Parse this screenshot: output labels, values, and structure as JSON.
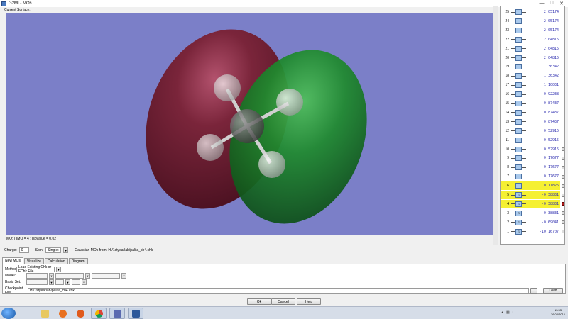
{
  "window": {
    "title": "G2MI - MOs",
    "controls": [
      "minimize",
      "maximize",
      "close"
    ]
  },
  "surface_label": "Current Surface:",
  "status_line": "MO: ( IMO = 4 ; Isovalue = 0.02 )",
  "mo_list": [
    {
      "num": "25",
      "energy": "2.05174",
      "occ": "",
      "highlight": false,
      "check": ""
    },
    {
      "num": "24",
      "energy": "2.05174",
      "occ": "",
      "highlight": false,
      "check": ""
    },
    {
      "num": "23",
      "energy": "2.05174",
      "occ": "",
      "highlight": false,
      "check": ""
    },
    {
      "num": "22",
      "energy": "2.04815",
      "occ": "",
      "highlight": false,
      "check": ""
    },
    {
      "num": "21",
      "energy": "2.04815",
      "occ": "",
      "highlight": false,
      "check": ""
    },
    {
      "num": "20",
      "energy": "2.04815",
      "occ": "",
      "highlight": false,
      "check": ""
    },
    {
      "num": "19",
      "energy": "1.36342",
      "occ": "",
      "highlight": false,
      "check": ""
    },
    {
      "num": "18",
      "energy": "1.36342",
      "occ": "",
      "highlight": false,
      "check": ""
    },
    {
      "num": "17",
      "energy": "1.10031",
      "occ": "",
      "highlight": false,
      "check": ""
    },
    {
      "num": "16",
      "energy": "0.92238",
      "occ": "",
      "highlight": false,
      "check": ""
    },
    {
      "num": "15",
      "energy": "0.87437",
      "occ": "",
      "highlight": false,
      "check": ""
    },
    {
      "num": "14",
      "energy": "0.87437",
      "occ": "",
      "highlight": false,
      "check": ""
    },
    {
      "num": "13",
      "energy": "0.87437",
      "occ": "",
      "highlight": false,
      "check": ""
    },
    {
      "num": "12",
      "energy": "0.52915",
      "occ": "",
      "highlight": false,
      "check": ""
    },
    {
      "num": "11",
      "energy": "0.52915",
      "occ": "",
      "highlight": false,
      "check": ""
    },
    {
      "num": "10",
      "energy": "0.52915",
      "occ": "",
      "highlight": false,
      "check": "off"
    },
    {
      "num": "9",
      "energy": "0.17677",
      "occ": "",
      "highlight": false,
      "check": "off"
    },
    {
      "num": "8",
      "energy": "0.17677",
      "occ": "",
      "highlight": false,
      "check": "off"
    },
    {
      "num": "7",
      "energy": "0.17677",
      "occ": "",
      "highlight": false,
      "check": "off"
    },
    {
      "num": "6",
      "energy": "0.11826",
      "occ": "",
      "highlight": true,
      "check": "off"
    },
    {
      "num": "5",
      "energy": "-0.38831",
      "occ": "↑↓",
      "highlight": true,
      "check": "off"
    },
    {
      "num": "4",
      "energy": "-0.38831",
      "occ": "↑↓",
      "highlight": true,
      "check": "on"
    },
    {
      "num": "3",
      "energy": "-0.38831",
      "occ": "↑↓",
      "highlight": false,
      "check": "off"
    },
    {
      "num": "2",
      "energy": "-0.69041",
      "occ": "↑↓",
      "highlight": false,
      "check": "off"
    },
    {
      "num": "1",
      "energy": "-10.16707",
      "occ": "↑↓",
      "highlight": false,
      "check": "off"
    }
  ],
  "charge": {
    "label": "Charge:",
    "value": "0"
  },
  "spin": {
    "label": "Spin:",
    "value": "Singlet"
  },
  "mos_from": "Gaussian MOs from: H:/1styearlab/palita_ch4.chk",
  "tabs": [
    "New MOs",
    "Visualize",
    "Calculation",
    "Diagram"
  ],
  "active_tab": "New MOs",
  "method": {
    "label": "Method:",
    "value": "Load Existing Chk or FChk File"
  },
  "model_label": "Model:",
  "basis_label": "Basis Set:",
  "checkpoint": {
    "label": "Checkpoint File:",
    "value": "H:/1styearlab/palita_ch4.chk",
    "browse": "...",
    "load": "Load"
  },
  "buttons": {
    "ok": "Ok",
    "cancel": "Cancel",
    "help": "Help"
  },
  "taskbar": {
    "apps": [
      "start-orb",
      "explorer",
      "media-player",
      "firefox",
      "chrome",
      "gaussview",
      "word"
    ],
    "time": "13:53",
    "date": "26/02/2016"
  },
  "colors": {
    "viewport_bg": "#7b7fc8",
    "lobe_positive": "#6b1a2a",
    "lobe_negative": "#1e7a2a",
    "highlight": "#f5f032",
    "energy_text": "#3030b0"
  }
}
